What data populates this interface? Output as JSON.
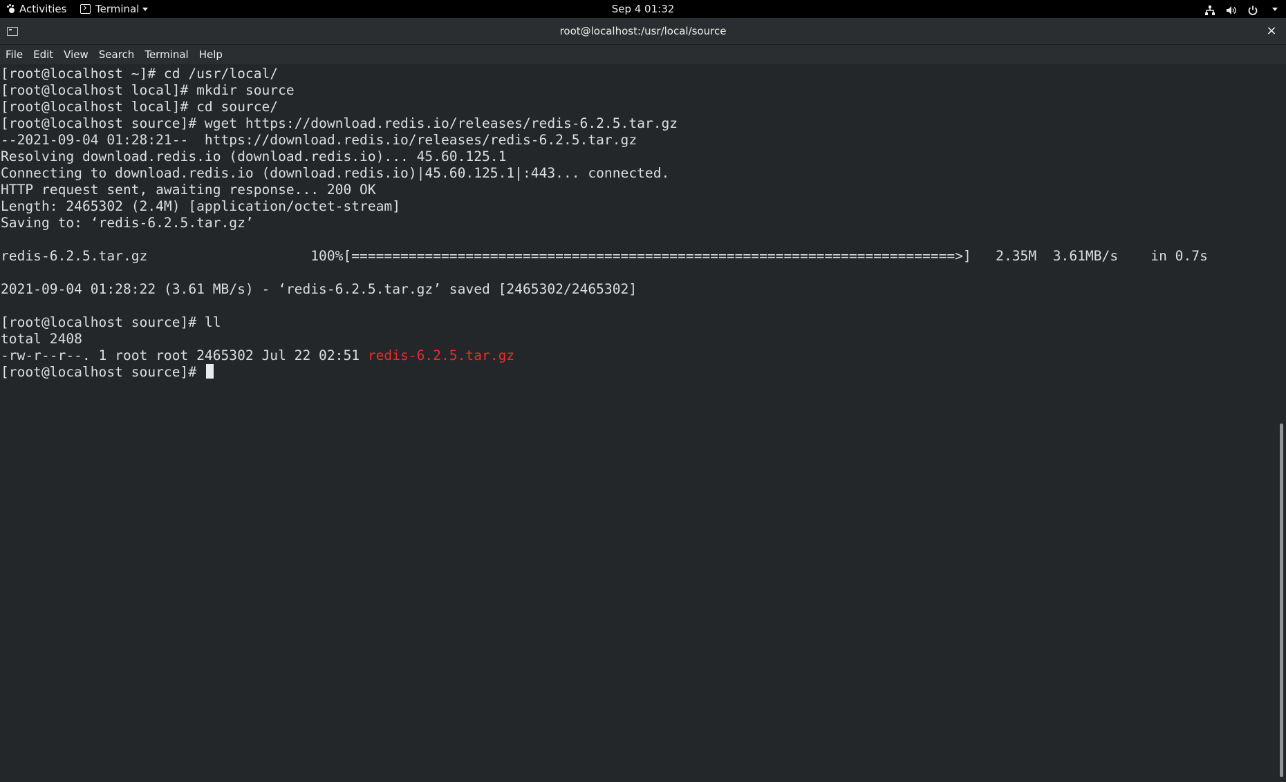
{
  "topbar": {
    "activities_label": "Activities",
    "app_menu_label": "Terminal",
    "clock": "Sep 4  01:32",
    "icons": [
      "network-icon",
      "volume-icon",
      "power-icon"
    ]
  },
  "window": {
    "title": "root@localhost:/usr/local/source",
    "close_glyph": "×"
  },
  "menubar": {
    "items": [
      "File",
      "Edit",
      "View",
      "Search",
      "Terminal",
      "Help"
    ]
  },
  "terminal": {
    "lines": [
      "[root@localhost ~]# cd /usr/local/",
      "[root@localhost local]# mkdir source",
      "[root@localhost local]# cd source/",
      "[root@localhost source]# wget https://download.redis.io/releases/redis-6.2.5.tar.gz",
      "--2021-09-04 01:28:21--  https://download.redis.io/releases/redis-6.2.5.tar.gz",
      "Resolving download.redis.io (download.redis.io)... 45.60.125.1",
      "Connecting to download.redis.io (download.redis.io)|45.60.125.1|:443... connected.",
      "HTTP request sent, awaiting response... 200 OK",
      "Length: 2465302 (2.4M) [application/octet-stream]",
      "Saving to: ‘redis-6.2.5.tar.gz’",
      "",
      "redis-6.2.5.tar.gz                    100%[==========================================================================>]   2.35M  3.61MB/s    in 0.7s",
      "",
      "2021-09-04 01:28:22 (3.61 MB/s) - ‘redis-6.2.5.tar.gz’ saved [2465302/2465302]",
      "",
      "[root@localhost source]# ll",
      "total 2408"
    ],
    "ls_entry_meta": "-rw-r--r--. 1 root root 2465302 Jul 22 02:51 ",
    "ls_entry_name": "redis-6.2.5.tar.gz",
    "prompt": "[root@localhost source]# ",
    "filename_color": "#ef2b2b"
  }
}
